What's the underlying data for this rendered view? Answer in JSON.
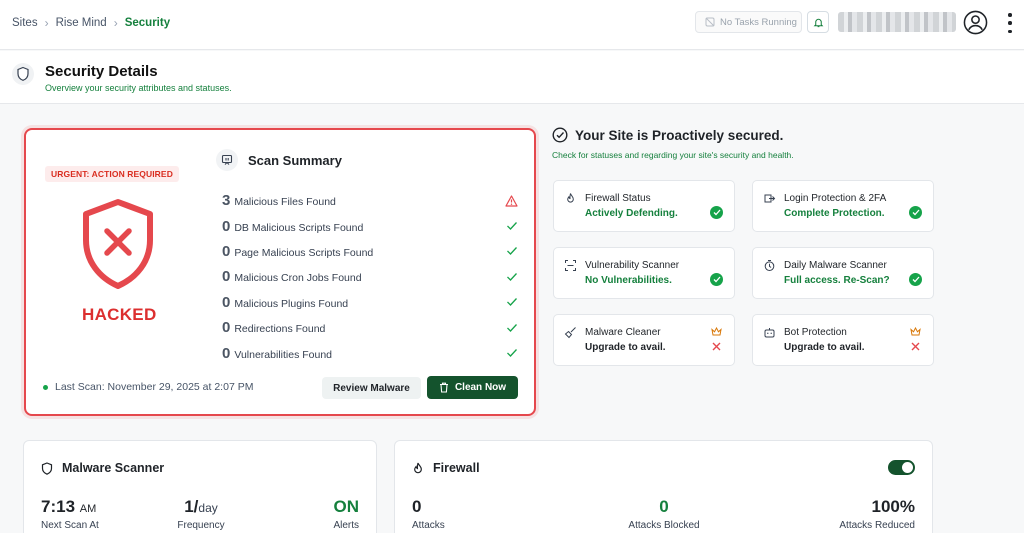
{
  "breadcrumb": [
    "Sites",
    "Rise Mind",
    "Security"
  ],
  "topbar": {
    "tasks_label": "No Tasks Running"
  },
  "page": {
    "title": "Security Details",
    "subtitle": "Overview your security attributes and statuses."
  },
  "scan_summary": {
    "urgent_label": "URGENT: ACTION REQUIRED",
    "status_label": "HACKED",
    "title": "Scan Summary",
    "findings": [
      {
        "count": "3",
        "label": "Malicious Files Found",
        "status": "warning"
      },
      {
        "count": "0",
        "label": "DB Malicious Scripts Found",
        "status": "ok"
      },
      {
        "count": "0",
        "label": "Page Malicious Scripts Found",
        "status": "ok"
      },
      {
        "count": "0",
        "label": "Malicious Cron Jobs Found",
        "status": "ok"
      },
      {
        "count": "0",
        "label": "Malicious Plugins Found",
        "status": "ok"
      },
      {
        "count": "0",
        "label": "Redirections Found",
        "status": "ok"
      },
      {
        "count": "0",
        "label": "Vulnerabilities Found",
        "status": "ok"
      }
    ],
    "last_scan": "Last Scan: November 29, 2025 at 2:07 PM",
    "review_button": "Review Malware",
    "clean_button": "Clean Now"
  },
  "proactive": {
    "title": "Your Site is Proactively secured.",
    "subtitle": "Check for statuses and regarding your site's security and health.",
    "tiles": [
      {
        "icon": "flame-icon",
        "title": "Firewall Status",
        "status": "Actively Defending.",
        "state": "ok"
      },
      {
        "icon": "login-icon",
        "title": "Login Protection & 2FA",
        "status": "Complete Protection.",
        "state": "ok"
      },
      {
        "icon": "scan-icon",
        "title": "Vulnerability Scanner",
        "status": "No Vulnerabilities.",
        "state": "ok"
      },
      {
        "icon": "timer-icon",
        "title": "Daily Malware Scanner",
        "status": "Full access. Re-Scan?",
        "state": "ok"
      },
      {
        "icon": "broom-icon",
        "title": "Malware Cleaner",
        "status": "Upgrade to avail.",
        "state": "locked"
      },
      {
        "icon": "bot-icon",
        "title": "Bot Protection",
        "status": "Upgrade to avail.",
        "state": "locked"
      }
    ]
  },
  "malware_scanner": {
    "title": "Malware Scanner",
    "next_scan_time": "7:13",
    "next_scan_ampm": "AM",
    "next_scan_label": "Next Scan At",
    "frequency_value": "1/",
    "frequency_unit": "day",
    "frequency_label": "Frequency",
    "alerts_value": "ON",
    "alerts_label": "Alerts"
  },
  "firewall": {
    "title": "Firewall",
    "attacks_value": "0",
    "attacks_label": "Attacks",
    "blocked_value": "0",
    "blocked_label": "Attacks Blocked",
    "reduced_value": "100%",
    "reduced_label": "Attacks Reduced",
    "enabled": true
  },
  "colors": {
    "accent": "#15803d",
    "danger": "#dc2f2f",
    "primary_button": "#14532d"
  }
}
